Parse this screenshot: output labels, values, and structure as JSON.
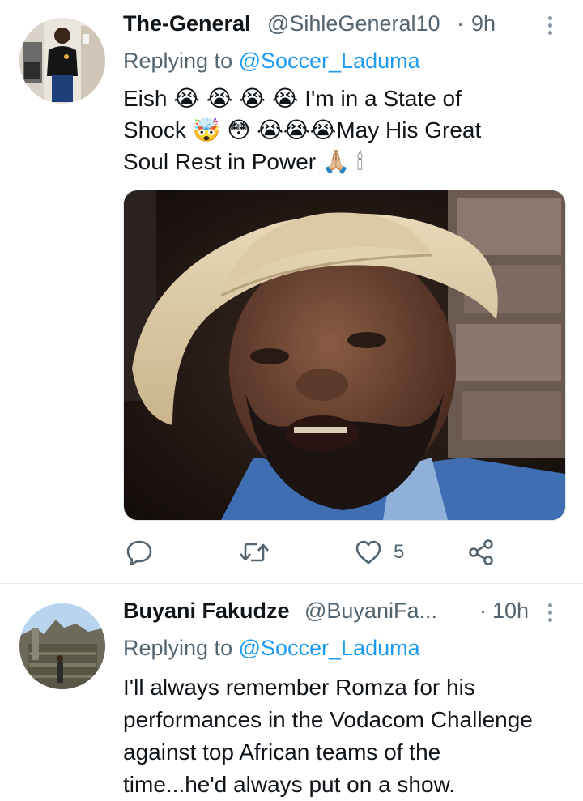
{
  "tweets": [
    {
      "author_name": "The-General",
      "author_handle": "@SihleGeneral10",
      "separator": "·",
      "time": "9h",
      "replying_label": "Replying to",
      "replying_to": "@Soccer_Laduma",
      "text_lines": [
        "Eish 😭 😭 😭 😭 I'm in a State of",
        "Shock 🤯 😳 😭😭😭May His Great",
        "Soul Rest in Power 🙏🏼 🕯"
      ],
      "has_media": true,
      "like_count": "5"
    },
    {
      "author_name": "Buyani Fakudze",
      "author_handle": "@BuyaniFa...",
      "separator": "·",
      "time": "10h",
      "replying_label": "Replying to",
      "replying_to": "@Soccer_Laduma",
      "text_lines": [
        "I'll always remember Romza for his",
        "performances in the Vodacom Challenge",
        "against top African teams of the",
        "time...he'd always put on a show."
      ]
    }
  ],
  "icons": [
    "reply-icon",
    "retweet-icon",
    "like-icon",
    "share-icon",
    "more-icon"
  ],
  "colors": {
    "link": "#1d9bf0",
    "muted": "#536471",
    "text": "#0f1419",
    "divider": "#e6ecf0"
  }
}
